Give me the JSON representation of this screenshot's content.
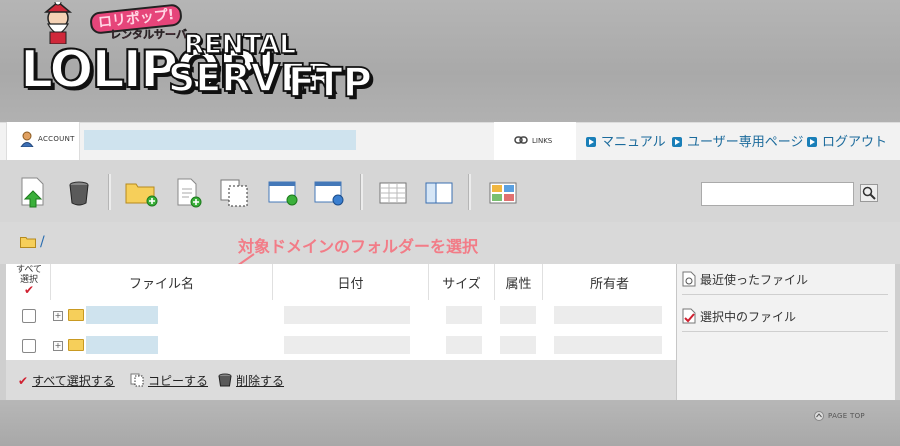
{
  "header": {
    "logo_main": "LOLIPOP!",
    "logo_rental": "RENTAL",
    "logo_server": "SERVER",
    "logo_ftp": "FTP",
    "logo_jp": "ロリポップ!",
    "logo_jp_sub": "レンタルサーバー"
  },
  "account_bar": {
    "account_label": "ACCOUNT",
    "links_label": "LINKS",
    "nav_links": [
      "マニュアル",
      "ユーザー専用ページ",
      "ログアウト"
    ]
  },
  "toolbar": {
    "icons": [
      "upload-icon",
      "trash-icon",
      "new-folder-icon",
      "new-file-icon",
      "copy-icon",
      "move-window-icon",
      "web-window-icon",
      "list-view-icon",
      "column-view-icon",
      "thumbnail-view-icon"
    ],
    "search_value": ""
  },
  "path": {
    "current": "/",
    "annotation": "対象ドメインのフォルダーを選択"
  },
  "table": {
    "select_all": "すべて\n選択",
    "headers": [
      "ファイル名",
      "日付",
      "サイズ",
      "属性",
      "所有者"
    ],
    "rows_count_visible": 2
  },
  "actions": {
    "select_all": "すべて選択する",
    "copy": "コピーする",
    "delete": "削除する"
  },
  "right_panel": {
    "recent_files": "最近使ったファイル",
    "selected_files": "選択中のファイル"
  },
  "footer": {
    "page_top": "PAGE TOP"
  },
  "colors": {
    "link_blue": "#1c6b9c",
    "annotation_pink": "#f27c87",
    "folder_yellow": "#f6cf5a",
    "check_red": "#d02030"
  }
}
